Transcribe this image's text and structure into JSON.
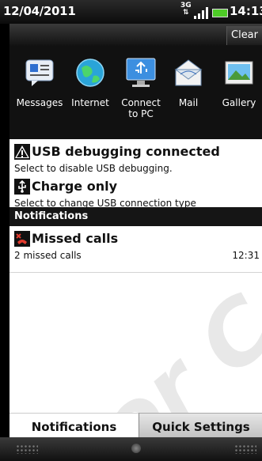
{
  "status_bar": {
    "date": "12/04/2011",
    "network": "3G",
    "time": "14:13"
  },
  "panel": {
    "clear_label": "Clear"
  },
  "recent_apps": [
    {
      "label": "Messages",
      "icon": "messages-icon"
    },
    {
      "label": "Internet",
      "icon": "globe-icon"
    },
    {
      "label": "Connect to PC",
      "icon": "pc-usb-icon"
    },
    {
      "label": "Mail",
      "icon": "mail-icon"
    },
    {
      "label": "Gallery",
      "icon": "gallery-icon"
    }
  ],
  "items": {
    "usb_debugging": {
      "title": "USB debugging connected",
      "subtitle": "Select to disable USB debugging."
    },
    "charge_only": {
      "title": "Charge only",
      "subtitle": "Select to change USB connection type"
    }
  },
  "notifications": {
    "header": "Notifications",
    "missed_calls": {
      "title": "Missed calls",
      "subtitle": "2 missed calls",
      "time": "12:31"
    }
  },
  "watermark": "Not For Certification",
  "tabs": {
    "notifications": "Notifications",
    "quick_settings": "Quick Settings"
  }
}
